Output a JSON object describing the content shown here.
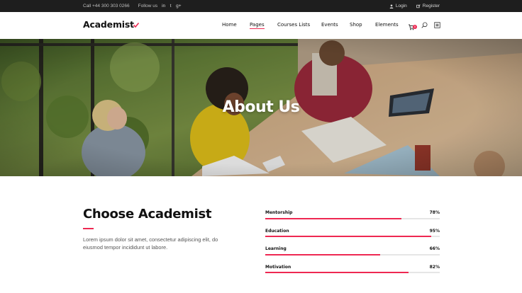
{
  "topbar": {
    "phone": "Call +44 300 303 0266",
    "follow_label": "Follow us",
    "social": [
      {
        "icon": "linkedin-icon",
        "glyph": "in"
      },
      {
        "icon": "twitter-icon",
        "glyph": "t"
      },
      {
        "icon": "google-plus-icon",
        "glyph": "g+"
      }
    ],
    "login_label": "Login",
    "register_label": "Register"
  },
  "header": {
    "logo": "Academist",
    "nav": [
      {
        "label": "Home",
        "active": false
      },
      {
        "label": "Pages",
        "active": true
      },
      {
        "label": "Courses Lists",
        "active": false
      },
      {
        "label": "Events",
        "active": false
      },
      {
        "label": "Shop",
        "active": false
      },
      {
        "label": "Elements",
        "active": false
      }
    ],
    "cart_count": "0",
    "icons": [
      "cart-icon",
      "search-icon",
      "menu-list-icon"
    ]
  },
  "hero": {
    "title": "About Us"
  },
  "about": {
    "title": "Choose Academist",
    "text": "Lorem ipsum dolor sit amet, consectetur adipiscing elit, do eiusmod tempor incididunt ut labore.",
    "skills": [
      {
        "label": "Mentorship",
        "value": "78%",
        "percent": 78
      },
      {
        "label": "Education",
        "value": "95%",
        "percent": 95
      },
      {
        "label": "Learning",
        "value": "66%",
        "percent": 66
      },
      {
        "label": "Motivation",
        "value": "82%",
        "percent": 82
      }
    ]
  },
  "colors": {
    "accent": "#ee2852",
    "topbar_bg": "#1e1e1e",
    "track": "#e6e6e6"
  }
}
